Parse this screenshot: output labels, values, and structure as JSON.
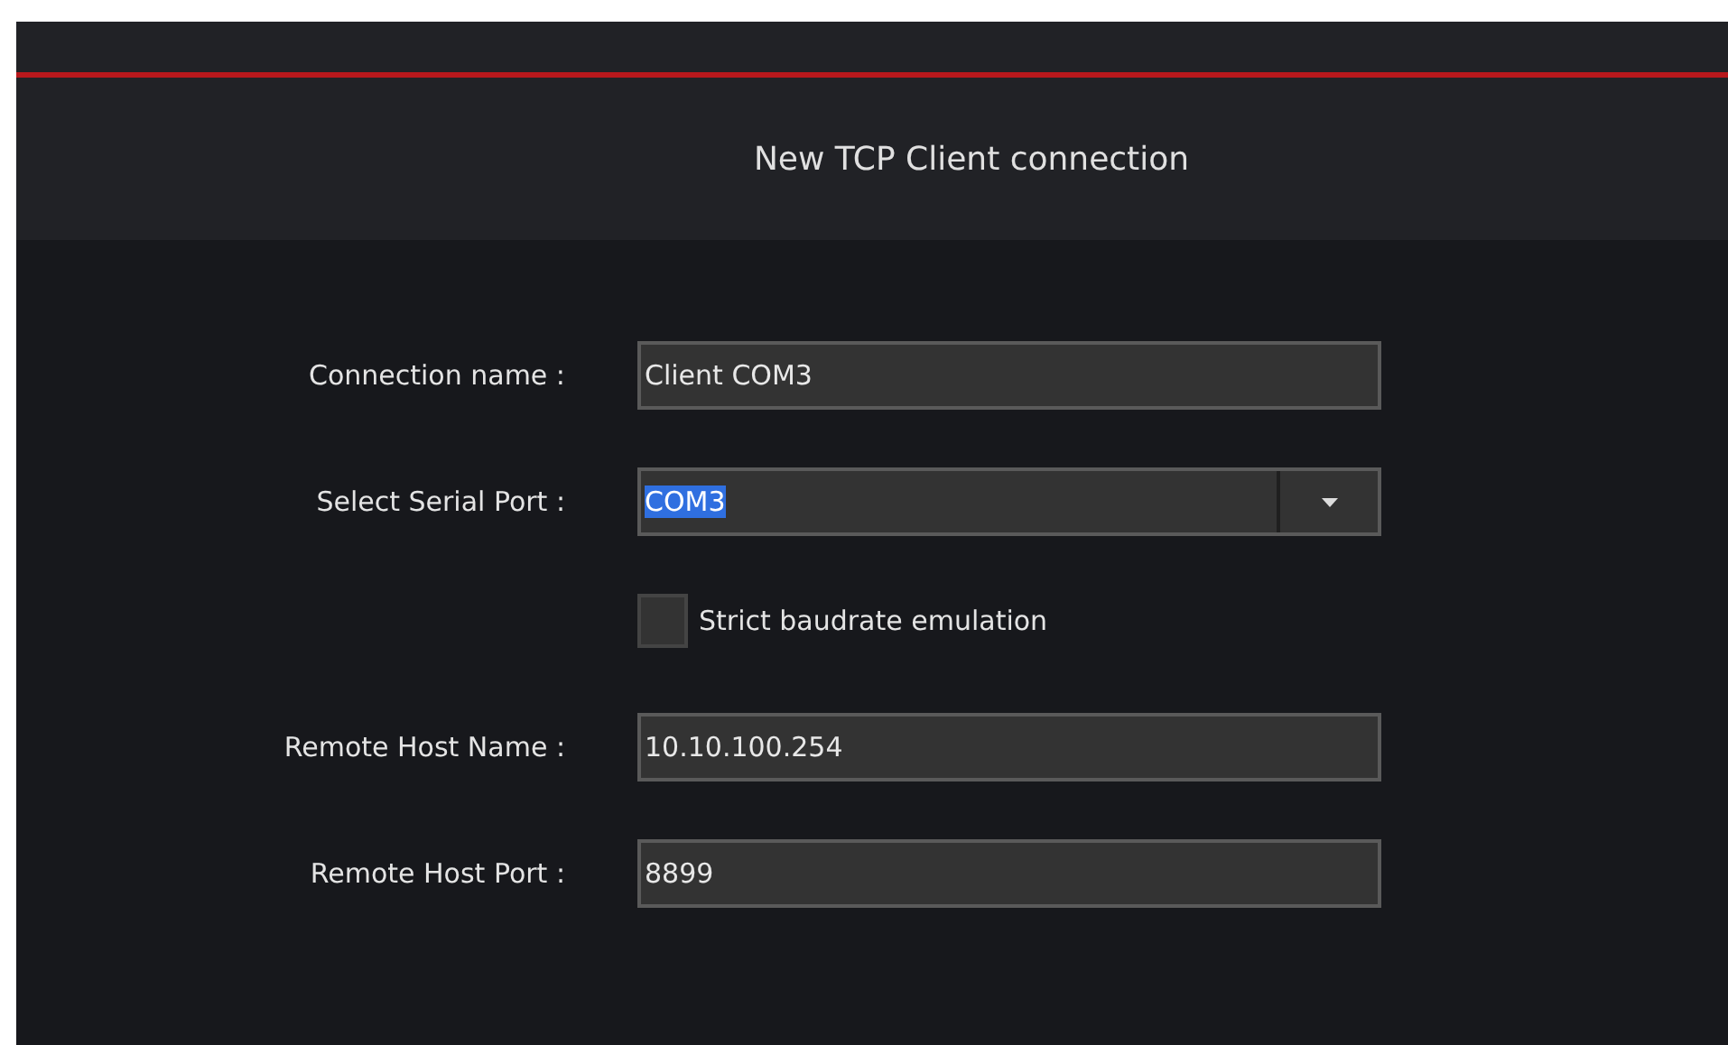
{
  "dialog": {
    "title": "New TCP Client connection"
  },
  "rows": [
    {
      "kind": "text",
      "label": "Connection name :",
      "value": "Client COM3"
    },
    {
      "kind": "select",
      "label": "Select Serial Port :",
      "value": "COM3",
      "text_selected": true
    },
    {
      "kind": "checkbox",
      "label": "Strict baudrate emulation",
      "checked": false
    },
    {
      "kind": "text",
      "label": "Remote Host Name :",
      "value": "10.10.100.254"
    },
    {
      "kind": "text",
      "label": "Remote Host Port :",
      "value": "8899"
    }
  ]
}
